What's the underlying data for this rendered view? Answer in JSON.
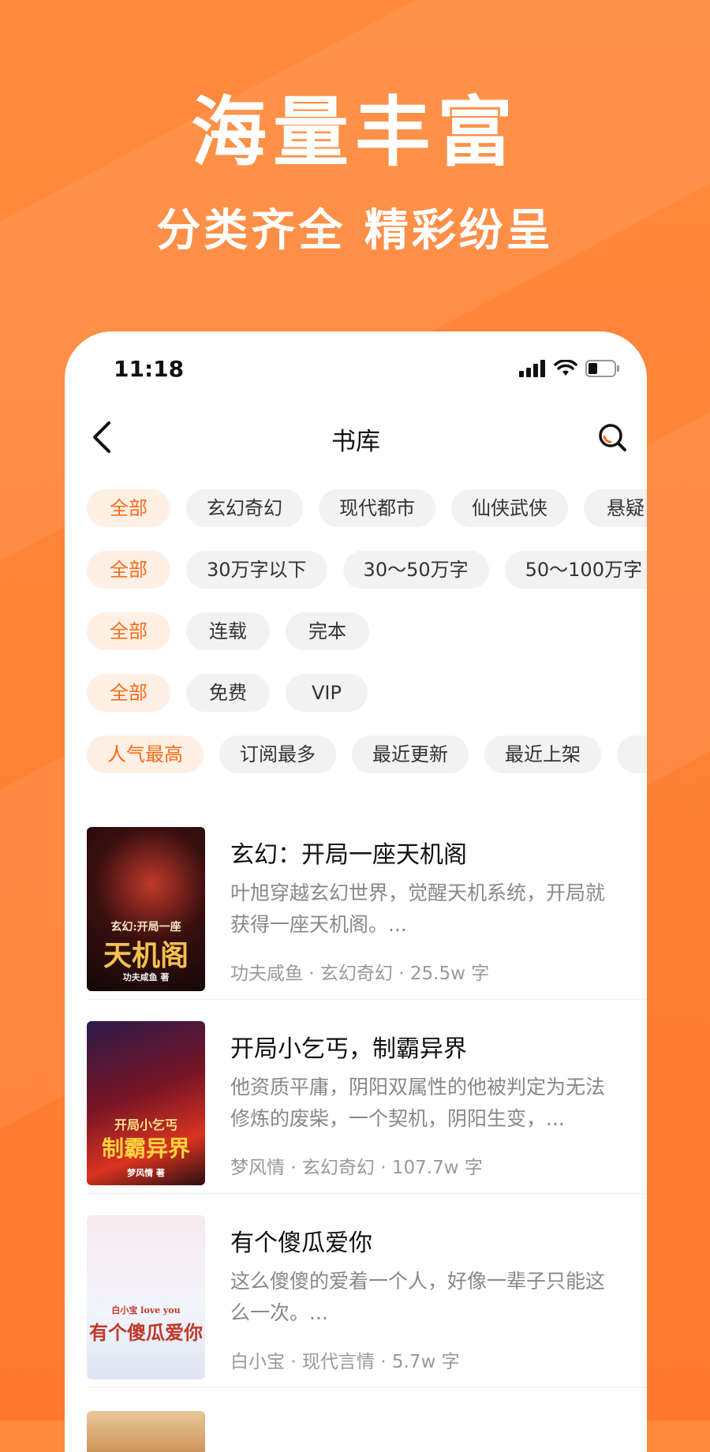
{
  "hero": {
    "title": "海量丰富",
    "subtitle": "分类齐全 精彩纷呈"
  },
  "status": {
    "time": "11:18"
  },
  "nav": {
    "title": "书库"
  },
  "filters": {
    "category": [
      "全部",
      "玄幻奇幻",
      "现代都市",
      "仙侠武侠",
      "悬疑"
    ],
    "word_count": [
      "全部",
      "30万字以下",
      "30～50万字",
      "50～100万字"
    ],
    "status": [
      "全部",
      "连载",
      "完本"
    ],
    "price": [
      "全部",
      "免费",
      "VIP"
    ],
    "sort": [
      "人气最高",
      "订阅最多",
      "最近更新",
      "最近上架"
    ]
  },
  "books": [
    {
      "title": "玄幻：开局一座天机阁",
      "desc": "叶旭穿越玄幻世界，觉醒天机系统，开局就获得一座天机阁。...",
      "meta": "功夫咸鱼 · 玄幻奇幻 · 25.5w 字",
      "cover_small": "玄幻:开局一座",
      "cover_big": "天机阁",
      "cover_author": "功夫咸鱼 著"
    },
    {
      "title": "开局小乞丐，制霸异界",
      "desc": "他资质平庸，阴阳双属性的他被判定为无法修炼的废柴，一个契机，阴阳生变，...",
      "meta": "梦风情 · 玄幻奇幻 · 107.7w 字",
      "cover_small": "开局小乞丐",
      "cover_big": "制霸异界",
      "cover_author": "梦风情 著"
    },
    {
      "title": "有个傻瓜爱你",
      "desc": "这么傻傻的爱着一个人，好像一辈子只能这么一次。...",
      "meta": "白小宝 · 现代言情 · 5.7w 字",
      "cover_small": "白小宝 love you",
      "cover_big": "有个傻瓜爱你",
      "cover_author": ""
    }
  ],
  "colors": {
    "accent": "#ff6b1a",
    "background": "#ff7f35"
  }
}
